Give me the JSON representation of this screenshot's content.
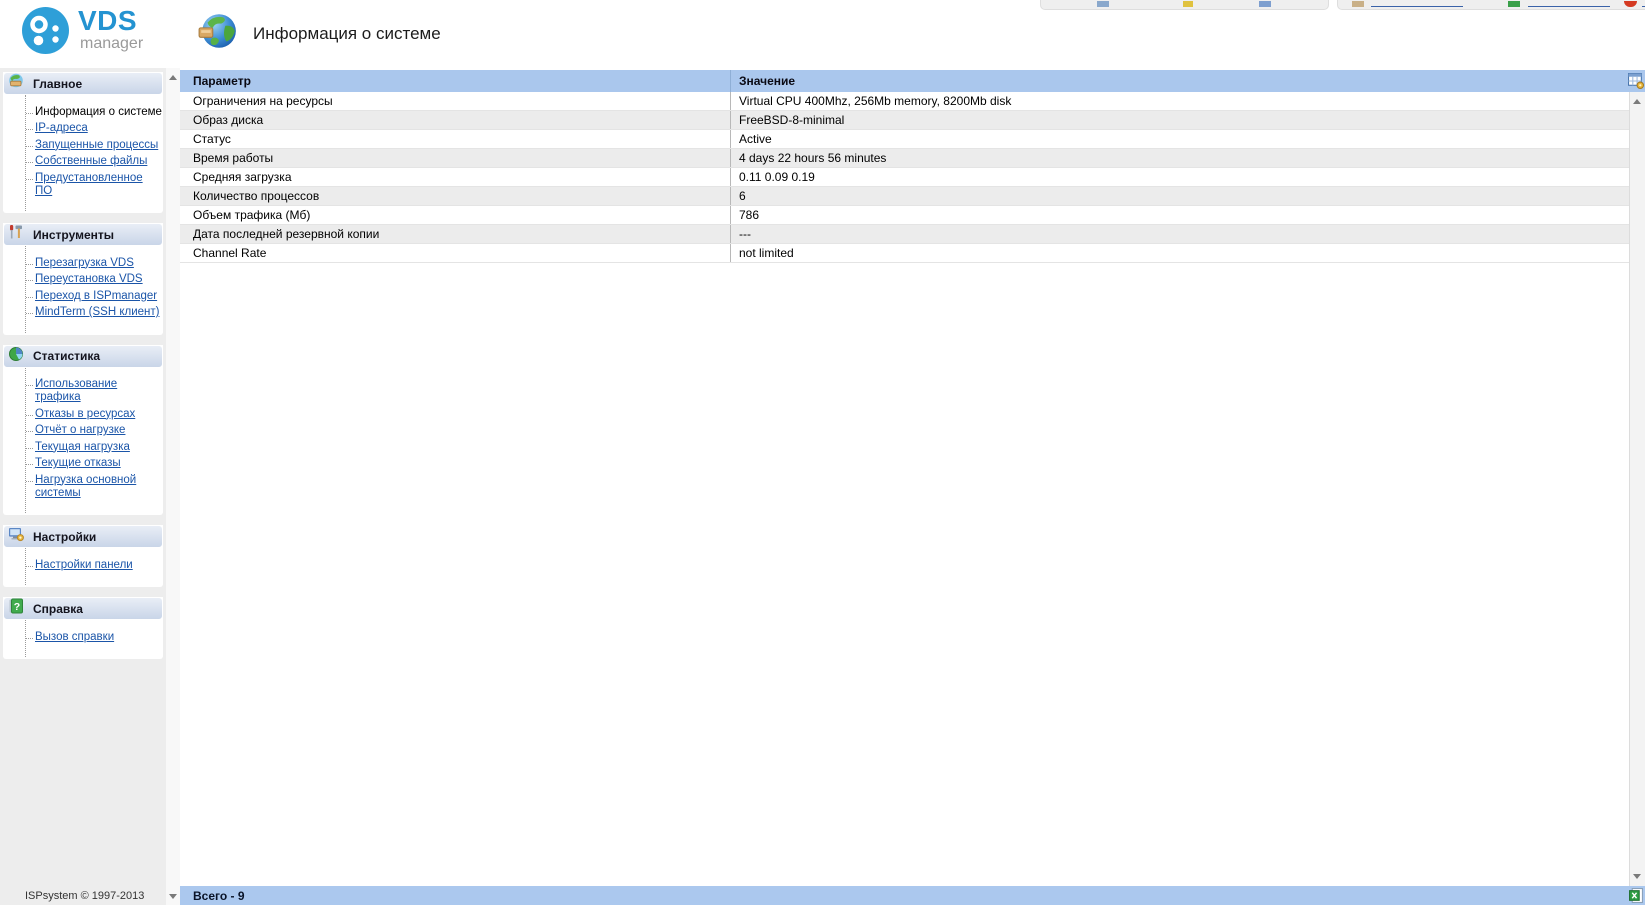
{
  "app": {
    "logo_primary": "VDS",
    "logo_secondary": "manager"
  },
  "page": {
    "title": "Информация о системе",
    "icon": "globe-network-icon"
  },
  "top_toolbar": {
    "partial_icons": [
      "keyboard-icon",
      "plus-minus-icon",
      "disk-icon",
      "user-settings-icon",
      "green-panel-icon",
      "logout-icon"
    ]
  },
  "sidebar": {
    "footer": "ISPsystem © 1997-2013",
    "sections": [
      {
        "label": "Главное",
        "icon": "globe-icon",
        "items": [
          {
            "label": "Информация о системе",
            "current": true
          },
          {
            "label": "IP-адреса",
            "current": false
          },
          {
            "label": "Запущенные процессы",
            "current": false
          },
          {
            "label": "Собственные файлы",
            "current": false
          },
          {
            "label": "Предустановленное ПО",
            "current": false
          }
        ]
      },
      {
        "label": "Инструменты",
        "icon": "tools-icon",
        "items": [
          {
            "label": "Перезагрузка VDS",
            "current": false
          },
          {
            "label": "Переустановка VDS",
            "current": false
          },
          {
            "label": "Переход в ISPmanager",
            "current": false
          },
          {
            "label": "MindTerm (SSH клиент)",
            "current": false
          }
        ]
      },
      {
        "label": "Статистика",
        "icon": "pie-chart-icon",
        "items": [
          {
            "label": "Использование трафика",
            "current": false
          },
          {
            "label": "Отказы в ресурсах",
            "current": false
          },
          {
            "label": "Отчёт о нагрузке",
            "current": false
          },
          {
            "label": "Текущая нагрузка",
            "current": false
          },
          {
            "label": "Текущие отказы",
            "current": false
          },
          {
            "label": "Нагрузка основной системы",
            "current": false
          }
        ]
      },
      {
        "label": "Настройки",
        "icon": "monitor-settings-icon",
        "items": [
          {
            "label": "Настройки панели",
            "current": false
          }
        ]
      },
      {
        "label": "Справка",
        "icon": "help-icon",
        "items": [
          {
            "label": "Вызов справки",
            "current": false
          }
        ]
      }
    ]
  },
  "table": {
    "columns": [
      "Параметр",
      "Значение"
    ],
    "rows": [
      [
        "Ограничения на ресурсы",
        "Virtual CPU 400Mhz, 256Mb memory, 8200Mb disk"
      ],
      [
        "Образ диска",
        "FreeBSD-8-minimal"
      ],
      [
        "Статус",
        "Active"
      ],
      [
        "Время работы",
        "4 days 22 hours 56 minutes"
      ],
      [
        "Средняя загрузка",
        "0.11 0.09 0.19"
      ],
      [
        "Количество процессов",
        "6"
      ],
      [
        "Объем трафика (Мб)",
        "786"
      ],
      [
        "Дата последней резервной копии",
        "---"
      ],
      [
        "Channel Rate",
        "not limited"
      ]
    ]
  },
  "footer": {
    "total_label": "Всего - 9"
  },
  "colors": {
    "header_blue": "#aac7ed",
    "link_blue": "#1b55a8",
    "alt_row": "#ececec",
    "sidebar_bg": "#ededed",
    "logo_blue": "#2e9fd8"
  }
}
